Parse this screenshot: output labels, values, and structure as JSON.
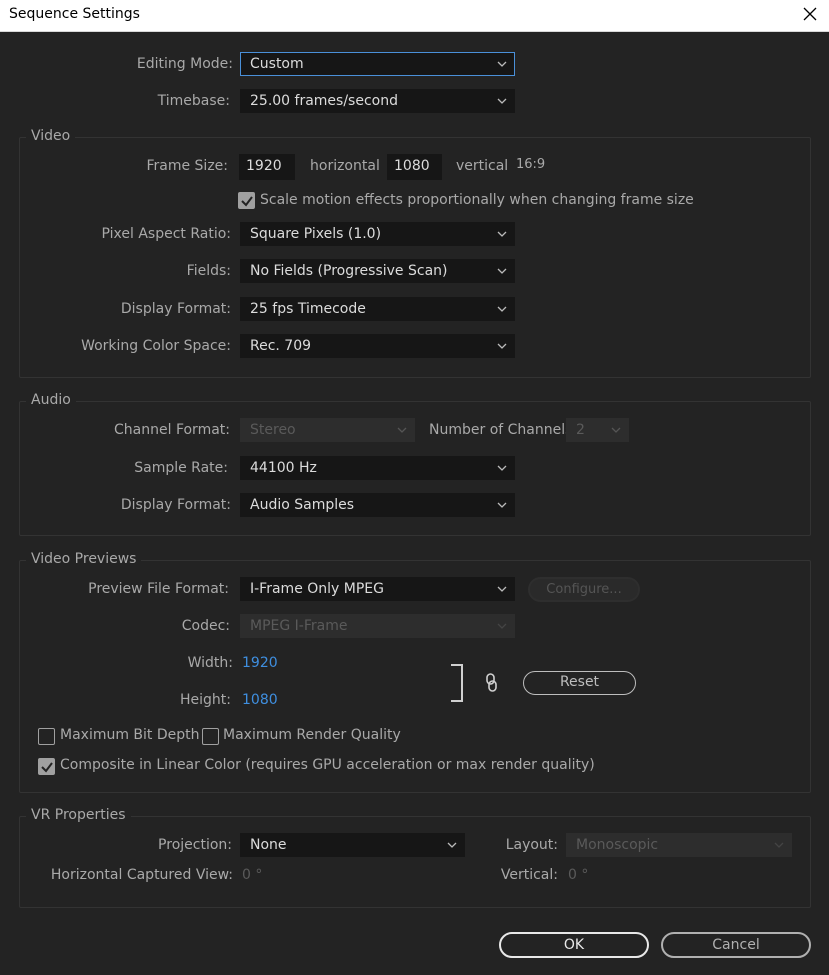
{
  "window": {
    "title": "Sequence Settings",
    "close_icon": "close-icon"
  },
  "general": {
    "editing_mode_label": "Editing Mode:",
    "editing_mode_value": "Custom",
    "timebase_label": "Timebase:",
    "timebase_value": "25.00  frames/second"
  },
  "video": {
    "group_title": "Video",
    "frame_size_label": "Frame Size:",
    "frame_width": "1920",
    "horizontal_label": "horizontal",
    "frame_height": "1080",
    "vertical_label": "vertical",
    "aspect": "16:9",
    "scale_checkbox_label": "Scale motion effects proportionally when changing frame size",
    "scale_checked": true,
    "pixel_aspect_label": "Pixel Aspect Ratio:",
    "pixel_aspect_value": "Square Pixels (1.0)",
    "fields_label": "Fields:",
    "fields_value": "No Fields (Progressive Scan)",
    "display_format_label": "Display Format:",
    "display_format_value": "25 fps Timecode",
    "color_space_label": "Working Color Space:",
    "color_space_value": "Rec. 709"
  },
  "audio": {
    "group_title": "Audio",
    "channel_format_label": "Channel Format:",
    "channel_format_value": "Stereo",
    "num_channels_label": "Number of Channels:",
    "num_channels_value": "2",
    "sample_rate_label": "Sample Rate:",
    "sample_rate_value": "44100 Hz",
    "display_format_label": "Display Format:",
    "display_format_value": "Audio Samples"
  },
  "previews": {
    "group_title": "Video Previews",
    "file_format_label": "Preview File Format:",
    "file_format_value": "I-Frame Only MPEG",
    "configure_label": "Configure...",
    "codec_label": "Codec:",
    "codec_value": "MPEG I-Frame",
    "width_label": "Width:",
    "width_value": "1920",
    "height_label": "Height:",
    "height_value": "1080",
    "reset_label": "Reset",
    "max_bit_depth_label": "Maximum Bit Depth",
    "max_bit_depth_checked": false,
    "max_render_label": "Maximum Render Quality",
    "max_render_checked": false,
    "composite_label": "Composite in Linear Color (requires GPU acceleration or max render quality)",
    "composite_checked": true
  },
  "vr": {
    "group_title": "VR Properties",
    "projection_label": "Projection:",
    "projection_value": "None",
    "layout_label": "Layout:",
    "layout_value": "Monoscopic",
    "horizontal_view_label": "Horizontal Captured View:",
    "horizontal_view_value": "0 °",
    "vertical_label": "Vertical:",
    "vertical_value": "0 °"
  },
  "footer": {
    "ok_label": "OK",
    "cancel_label": "Cancel"
  },
  "colors": {
    "background": "#232323",
    "accent": "#4a90d9",
    "link_value": "#3f8fe0"
  }
}
